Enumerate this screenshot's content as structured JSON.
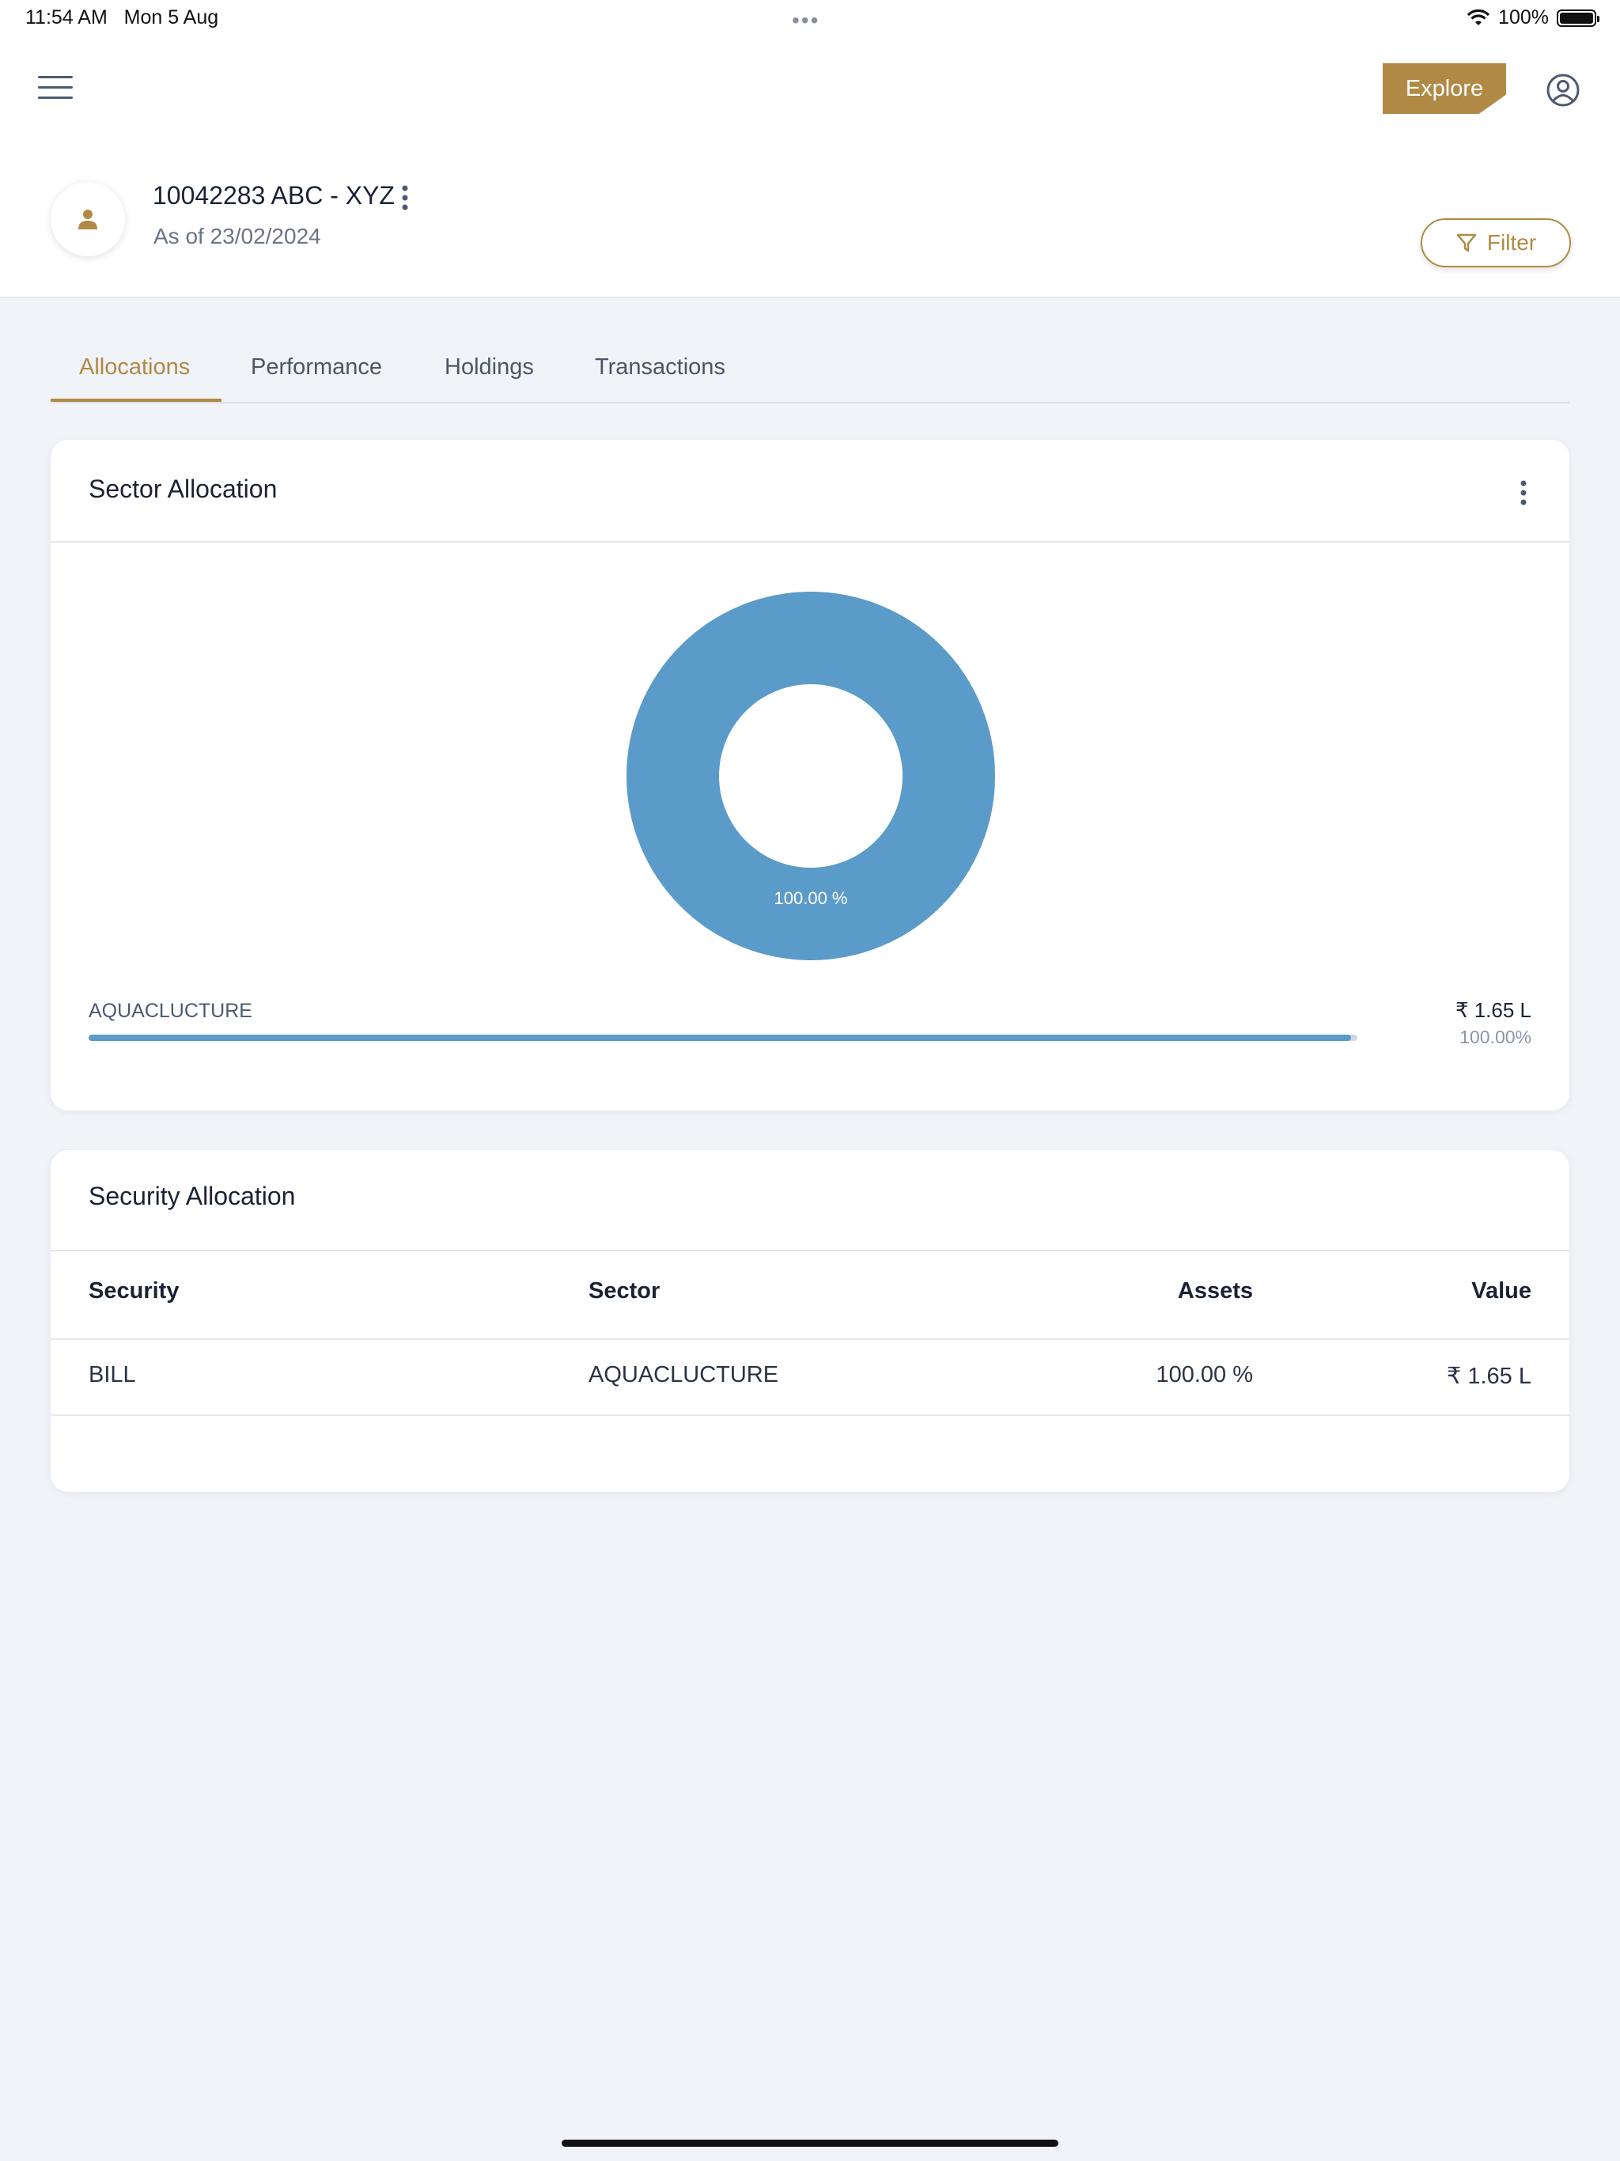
{
  "status_bar": {
    "time": "11:54 AM",
    "date": "Mon 5 Aug",
    "dots": "•••",
    "battery": "100%"
  },
  "header": {
    "explore_label": "Explore"
  },
  "account": {
    "title": "10042283 ABC - XYZ",
    "as_of": "As of 23/02/2024",
    "filter_label": "Filter"
  },
  "tabs": [
    {
      "label": "Allocations",
      "active": true
    },
    {
      "label": "Performance",
      "active": false
    },
    {
      "label": "Holdings",
      "active": false
    },
    {
      "label": "Transactions",
      "active": false
    }
  ],
  "sector_allocation": {
    "title": "Sector Allocation",
    "donut_label": "100.00 %",
    "bar": {
      "label": "AQUACLUCTURE",
      "value": "₹ 1.65 L",
      "percent_text": "100.00%",
      "fill_fraction": 0.995
    }
  },
  "chart_data": {
    "type": "pie",
    "categories": [
      "AQUACLUCTURE"
    ],
    "values": [
      100.0
    ],
    "title": "Sector Allocation",
    "colors": [
      "#5b9bc9"
    ]
  },
  "security_allocation": {
    "title": "Security Allocation",
    "columns": [
      "Security",
      "Sector",
      "Assets",
      "Value"
    ],
    "rows": [
      {
        "security": "BILL",
        "sector": "AQUACLUCTURE",
        "assets": "100.00 %",
        "value": "₹ 1.65 L"
      }
    ]
  },
  "colors": {
    "accent": "#b08a45",
    "chart_blue": "#5b9bc9",
    "background": "#f0f3f8"
  }
}
